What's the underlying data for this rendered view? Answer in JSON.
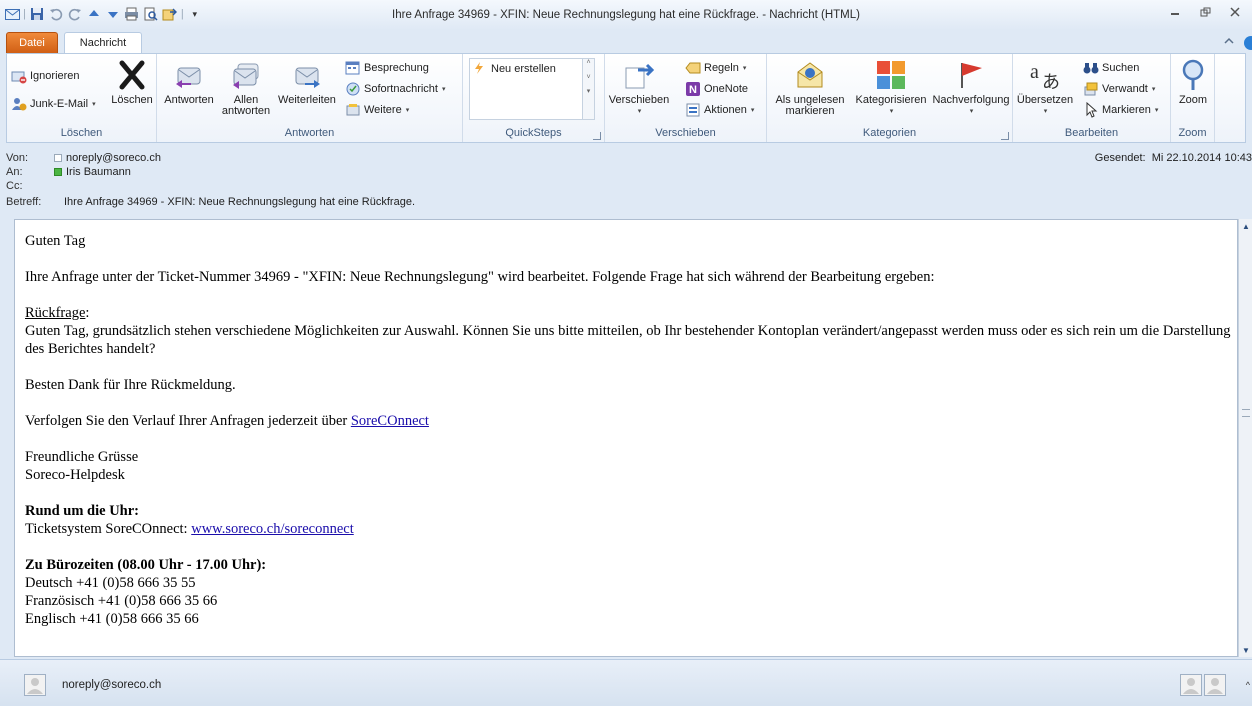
{
  "window": {
    "title": "Ihre Anfrage 34969 - XFIN: Neue Rechnungslegung hat eine Rückfrage.  -  Nachricht (HTML)"
  },
  "tabs": {
    "file": "Datei",
    "message": "Nachricht"
  },
  "ribbon": {
    "delete_group": {
      "label": "Löschen",
      "ignore": "Ignorieren",
      "junk": "Junk-E-Mail",
      "delete": "Löschen"
    },
    "respond_group": {
      "label": "Antworten",
      "reply": "Antworten",
      "reply_all_1": "Allen",
      "reply_all_2": "antworten",
      "forward": "Weiterleiten",
      "meeting": "Besprechung",
      "im": "Sofortnachricht",
      "more": "Weitere"
    },
    "quicksteps_group": {
      "label": "QuickSteps",
      "new": "Neu erstellen"
    },
    "move_group": {
      "label": "Verschieben",
      "move": "Verschieben",
      "rules": "Regeln",
      "onenote": "OneNote",
      "actions": "Aktionen"
    },
    "tags_group": {
      "label": "Kategorien",
      "unread_1": "Als ungelesen",
      "unread_2": "markieren",
      "categorize": "Kategorisieren",
      "followup": "Nachverfolgung"
    },
    "editing_group": {
      "label": "Bearbeiten",
      "translate": "Übersetzen",
      "find": "Suchen",
      "related": "Verwandt",
      "select": "Markieren"
    },
    "zoom_group": {
      "label": "Zoom",
      "zoom": "Zoom"
    }
  },
  "header": {
    "from_label": "Von:",
    "from": "noreply@soreco.ch",
    "to_label": "An:",
    "to": "Iris Baumann",
    "cc_label": "Cc:",
    "subject_label": "Betreff:",
    "subject": "Ihre Anfrage 34969 - XFIN: Neue Rechnungslegung hat eine Rückfrage.",
    "sent_label": "Gesendet:",
    "sent": "Mi 22.10.2014 10:43"
  },
  "body": {
    "greeting": "Guten Tag",
    "intro": "Ihre Anfrage unter der Ticket-Nummer 34969  - \"XFIN: Neue Rechnungslegung\" wird bearbeitet. Folgende Frage hat sich während der Bearbeitung ergeben:",
    "question_label": "Rückfrage",
    "question_colon": ":",
    "question": "Guten Tag, grundsätzlich stehen verschiedene Möglichkeiten zur Auswahl. Können Sie uns bitte mitteilen, ob Ihr bestehender Kontoplan verändert/angepasst werden muss oder es sich rein um die Darstellung des Berichtes handelt?",
    "thanks": "Besten Dank für Ihre Rückmeldung.",
    "follow_text": "Verfolgen Sie den Verlauf Ihrer Anfragen jederzeit über ",
    "follow_link": "SoreCOnnect",
    "regards": "Freundliche Grüsse",
    "signature": "Soreco-Helpdesk",
    "around_clock": "Rund um die Uhr:",
    "ticket_text": "Ticketsystem SoreCOnnect: ",
    "ticket_link": "www.soreco.ch/soreconnect",
    "office_hours": "Zu Bürozeiten (08.00 Uhr - 17.00 Uhr):",
    "phone_de": "Deutsch +41 (0)58 666 35 55",
    "phone_fr": "Französisch +41 (0)58 666 35 66",
    "phone_en": "Englisch +41 (0)58 666 35 66"
  },
  "people_pane": {
    "name": "noreply@soreco.ch"
  },
  "colors": {
    "file_tab": "#e06a1b",
    "link": "#1a0dab",
    "frame": "#dfe9f5"
  }
}
